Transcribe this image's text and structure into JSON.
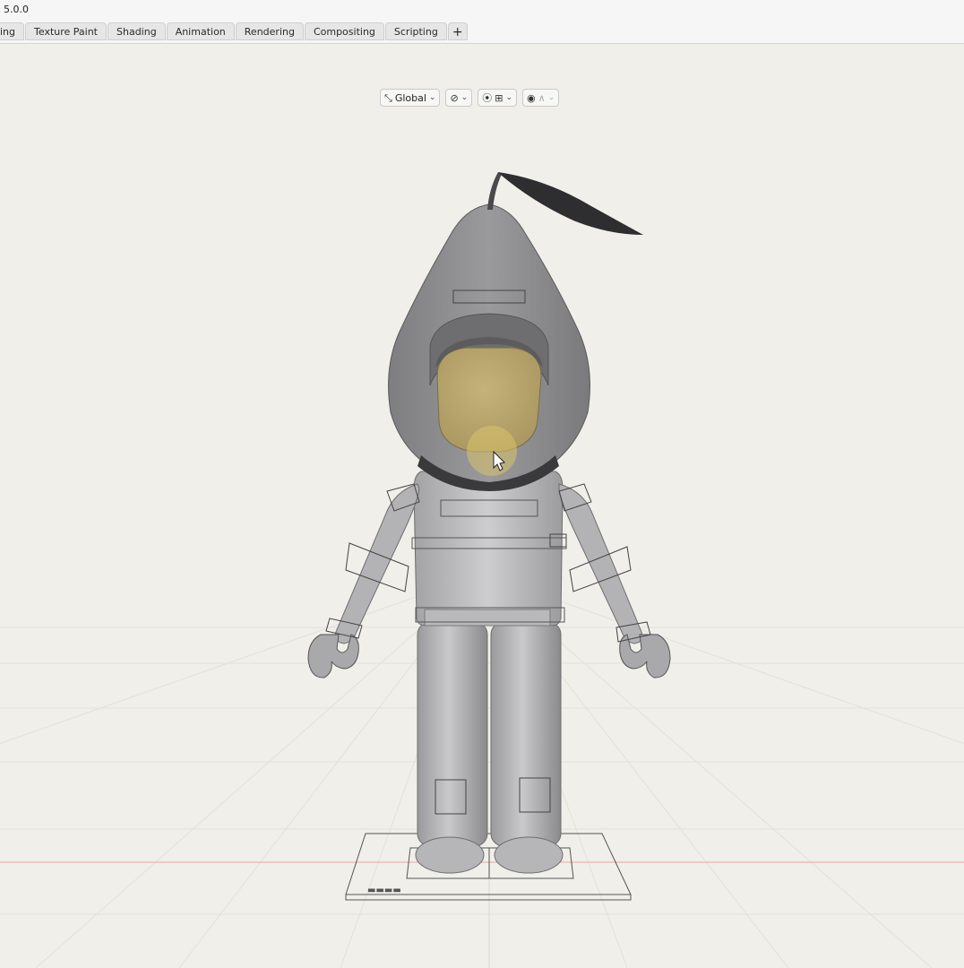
{
  "app": {
    "version": "5.0.0"
  },
  "workspace_tabs": [
    {
      "label": "ing"
    },
    {
      "label": "Texture Paint"
    },
    {
      "label": "Shading"
    },
    {
      "label": "Animation"
    },
    {
      "label": "Rendering"
    },
    {
      "label": "Compositing"
    },
    {
      "label": "Scripting"
    }
  ],
  "add_tab_label": "+",
  "viewport_header": {
    "transform_orientation": "Global",
    "icons": [
      "orientation-gizmo-icon",
      "pivot-link-icon",
      "snap-icon",
      "snap-increment-icon",
      "proportional-edit-icon",
      "falloff-curve-icon"
    ]
  },
  "colors": {
    "viewport_bg": "#f0efe9",
    "grid_line": "#e2e1da",
    "x_axis": "#e8a5a5",
    "model_grey": "#8c8c8e",
    "face_tone": "#b3a06a",
    "cursor_highlight": "#d9c36a"
  }
}
